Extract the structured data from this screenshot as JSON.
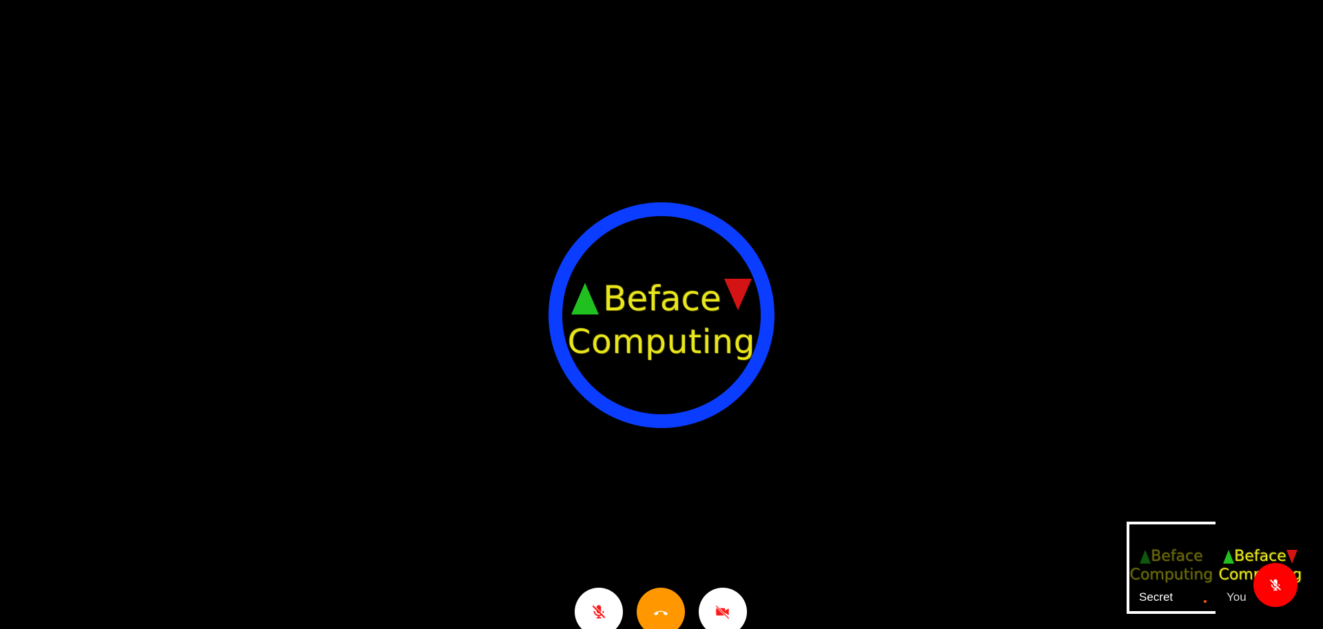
{
  "main": {
    "logo": {
      "line1": "Beface",
      "line2": "Computing"
    }
  },
  "participants": [
    {
      "name": "Secret",
      "logo_line1": "Beface",
      "logo_line2": "Computing"
    },
    {
      "name": "You",
      "logo_line1": "Beface",
      "logo_line2": "Computing"
    }
  ],
  "controls": {
    "mic": "mic-off-icon",
    "hangup": "phone-hangup-icon",
    "camera": "video-off-icon"
  },
  "colors": {
    "ring": "#0a3dff",
    "logo_text": "#e9e61d",
    "arrow_up": "#21c021",
    "arrow_down": "#d41414",
    "hangup": "#ff9800",
    "muted_badge": "#ff0000"
  }
}
